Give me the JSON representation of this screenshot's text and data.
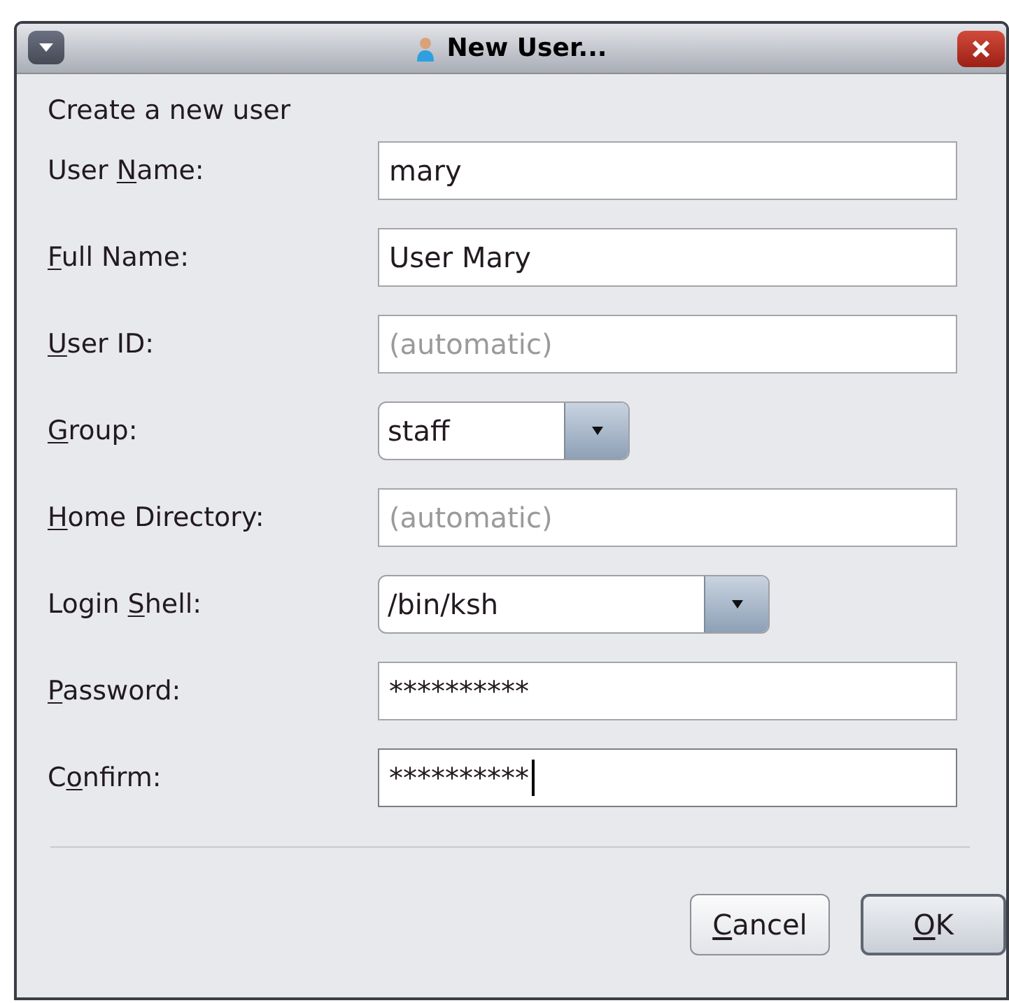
{
  "window": {
    "title": "New User..."
  },
  "heading": "Create a new user",
  "fields": [
    {
      "kind": "text",
      "label_before": "User ",
      "mnemonic": "N",
      "label_after": "ame:",
      "value": "mary",
      "focused": false
    },
    {
      "kind": "text",
      "mnemonic": "F",
      "label_after": "ull Name:",
      "value": "User Mary",
      "focused": false
    },
    {
      "kind": "text",
      "mnemonic": "U",
      "label_after": "ser ID:",
      "placeholder": "(automatic)",
      "focused": false
    },
    {
      "kind": "combo",
      "mnemonic": "G",
      "label_after": "roup:",
      "value": "staff"
    },
    {
      "kind": "text",
      "mnemonic": "H",
      "label_after": "ome Directory:",
      "placeholder": "(automatic)",
      "focused": false
    },
    {
      "kind": "combo",
      "label_before": "Login ",
      "mnemonic": "S",
      "label_after": "hell:",
      "value": "/bin/ksh"
    },
    {
      "kind": "password",
      "mnemonic": "P",
      "label_after": "assword:",
      "value": "**********",
      "focused": false
    },
    {
      "kind": "password",
      "label_before": "C",
      "mnemonic": "o",
      "label_after": "nfirm:",
      "value": "**********",
      "focused": true
    }
  ],
  "buttons": [
    {
      "mnemonic": "C",
      "label_after": "ancel",
      "default": false
    },
    {
      "mnemonic": "O",
      "label_after": "K",
      "default": true
    }
  ]
}
